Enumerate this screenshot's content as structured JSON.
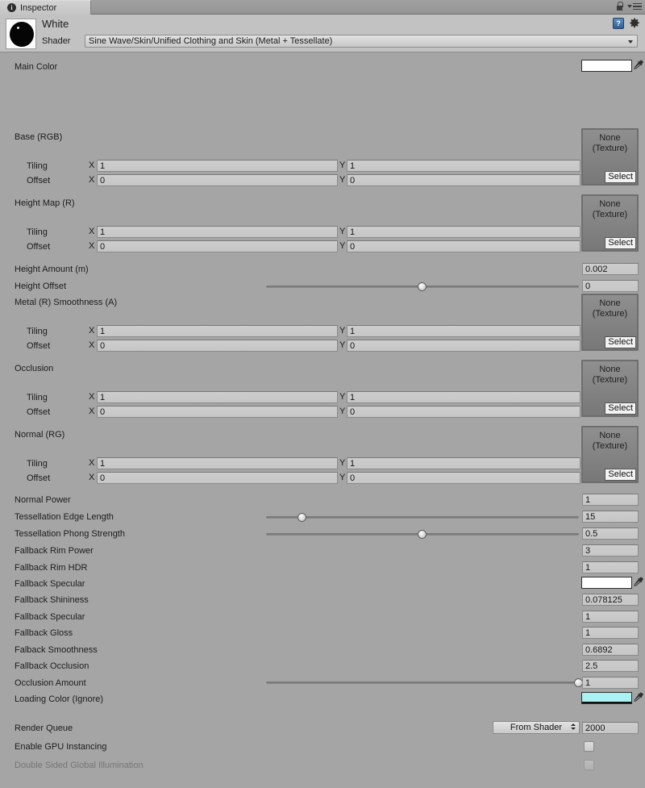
{
  "window": {
    "tab_label": "Inspector",
    "tab_icon": "info-icon",
    "lock_icon": "lock-icon",
    "menu_icon": "hamburger-menu-icon",
    "help_icon": "help-book-icon",
    "help_glyph": "?",
    "gear_icon": "gear-icon"
  },
  "material": {
    "name": "White",
    "shader_label": "Shader",
    "shader_value": "Sine Wave/Skin/Unified Clothing and Skin (Metal + Tessellate)",
    "preview_icon": "material-preview-sphere"
  },
  "labels": {
    "tiling": "Tiling",
    "offset": "Offset",
    "axis_x": "X",
    "axis_y": "Y",
    "none_texture_line1": "None",
    "none_texture_line2": "(Texture)",
    "select": "Select"
  },
  "colors": {
    "main_color": "#ffffff",
    "fallback_specular_color": "#ffffff",
    "loading_color": "#aaf2f2",
    "panel_bg": "#a5a5a5",
    "header_bg": "#c2c2c2"
  },
  "properties": {
    "main_color": {
      "label": "Main Color",
      "type": "color",
      "value": "#ffffff"
    },
    "base_rgb": {
      "label": "Base (RGB)",
      "texture": "None",
      "tiling": {
        "x": "1",
        "y": "1"
      },
      "offset": {
        "x": "0",
        "y": "0"
      }
    },
    "height_map": {
      "label": "Height Map (R)",
      "texture": "None",
      "tiling": {
        "x": "1",
        "y": "1"
      },
      "offset": {
        "x": "0",
        "y": "0"
      }
    },
    "height_amount": {
      "label": "Height Amount (m)",
      "type": "float",
      "value": "0.002"
    },
    "height_offset": {
      "label": "Height Offset",
      "type": "slider",
      "value": "0",
      "fill": 0.5
    },
    "metal_smoothness": {
      "label": "Metal (R) Smoothness (A)",
      "texture": "None",
      "tiling": {
        "x": "1",
        "y": "1"
      },
      "offset": {
        "x": "0",
        "y": "0"
      }
    },
    "occlusion": {
      "label": "Occlusion",
      "texture": "None",
      "tiling": {
        "x": "1",
        "y": "1"
      },
      "offset": {
        "x": "0",
        "y": "0"
      }
    },
    "normal_rg": {
      "label": "Normal (RG)",
      "texture": "None",
      "tiling": {
        "x": "1",
        "y": "1"
      },
      "offset": {
        "x": "0",
        "y": "0"
      }
    },
    "normal_power": {
      "label": "Normal Power",
      "type": "float",
      "value": "1"
    },
    "tessellation_edge_length": {
      "label": "Tessellation Edge Length",
      "type": "slider",
      "value": "15",
      "fill": 0.115
    },
    "tessellation_phong_strength": {
      "label": "Tessellation Phong Strength",
      "type": "slider",
      "value": "0.5",
      "fill": 0.5
    },
    "fallback_rim_power": {
      "label": "Fallback Rim Power",
      "type": "float",
      "value": "3"
    },
    "fallback_rim_hdr": {
      "label": "Fallback Rim HDR",
      "type": "float",
      "value": "1"
    },
    "fallback_specular_color": {
      "label": "Fallback Specular",
      "type": "color",
      "value": "#ffffff"
    },
    "fallback_shininess": {
      "label": "Fallback Shininess",
      "type": "float",
      "value": "0.078125"
    },
    "fallback_specular": {
      "label": "Fallback Specular",
      "type": "float",
      "value": "1"
    },
    "fallback_gloss": {
      "label": "Fallback Gloss",
      "type": "float",
      "value": "1"
    },
    "falback_smoothness": {
      "label": "Falback Smoothness",
      "type": "float",
      "value": "0.6892"
    },
    "fallback_occlusion": {
      "label": "Fallback Occlusion",
      "type": "float",
      "value": "2.5"
    },
    "occlusion_amount": {
      "label": "Occlusion Amount",
      "type": "slider",
      "value": "1",
      "fill": 1.0
    },
    "loading_color": {
      "label": "Loading Color (Ignore)",
      "type": "color",
      "value": "#aaf2f2"
    }
  },
  "footer": {
    "render_queue_label": "Render Queue",
    "render_queue_mode": "From Shader",
    "render_queue_value": "2000",
    "gpu_instancing_label": "Enable GPU Instancing",
    "gpu_instancing_checked": false,
    "double_sided_gi_label": "Double Sided Global Illumination",
    "double_sided_gi_checked": false,
    "double_sided_gi_disabled": true
  }
}
